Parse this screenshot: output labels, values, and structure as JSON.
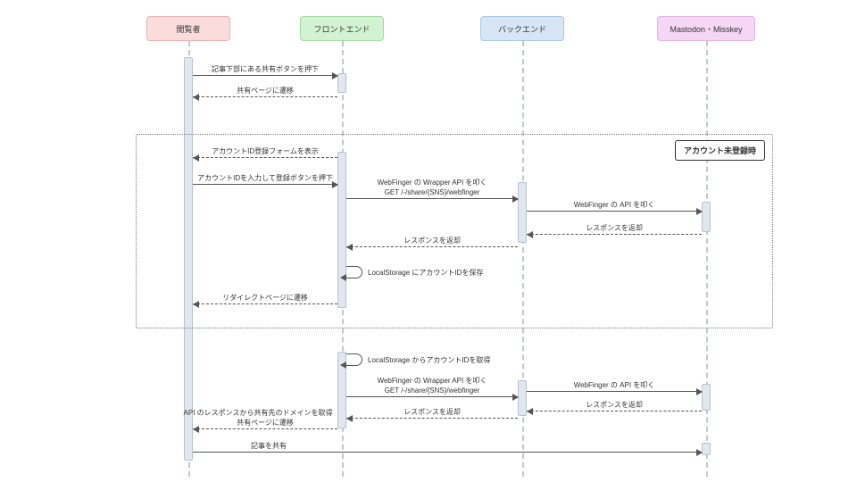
{
  "actors": {
    "viewer": "閲覧者",
    "frontend": "フロントエンド",
    "backend": "バックエンド",
    "server": "Mastodon・Misskey"
  },
  "frame_title": "アカウント未登録時",
  "msg": {
    "m1": "記事下部にある共有ボタンを押下",
    "m2": "共有ページに遷移",
    "m3": "アカウントID登録フォームを表示",
    "m4": "アカウントIDを入力して登録ボタンを押下",
    "m5a": "WebFinger の Wrapper API を叩く",
    "m5b": "GET /-/share/{SNS}/webfinger",
    "m6": "WebFinger の API を叩く",
    "m7": "レスポンスを返却",
    "m8": "レスポンスを返却",
    "m9": "LocalStorage にアカウントIDを保存",
    "m10": "リダイレクトページに遷移",
    "m11": "LocalStorage からアカウントIDを取得",
    "m12a": "WebFinger の Wrapper API を叩く",
    "m12b": "GET /-/share/{SNS}/webfinger",
    "m13": "WebFinger の API を叩く",
    "m14": "レスポンスを返却",
    "m15": "レスポンスを返却",
    "m16a": "API のレスポンスから共有先のドメインを取得",
    "m16b": "共有ページに遷移",
    "m17": "記事を共有"
  }
}
